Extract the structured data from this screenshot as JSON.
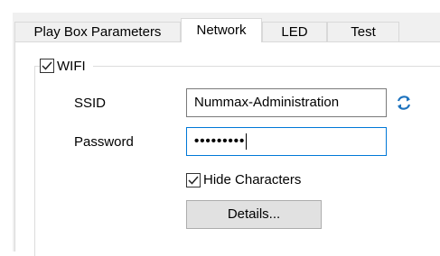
{
  "tabs": [
    {
      "label": "Play Box Parameters",
      "active": false
    },
    {
      "label": "Network",
      "active": true
    },
    {
      "label": "LED",
      "active": false
    },
    {
      "label": "Test",
      "active": false
    }
  ],
  "wifi": {
    "label": "WIFI",
    "checked": true,
    "ssid_label": "SSID",
    "ssid_value": "Nummax-Administration",
    "password_label": "Password",
    "password_masked": "•••••••••",
    "hide_characters_label": "Hide Characters",
    "hide_characters_checked": true,
    "details_label": "Details...",
    "refresh_icon": "refresh-icon"
  },
  "colors": {
    "accent": "#0078d7",
    "refresh_icon": "#1e73be"
  }
}
